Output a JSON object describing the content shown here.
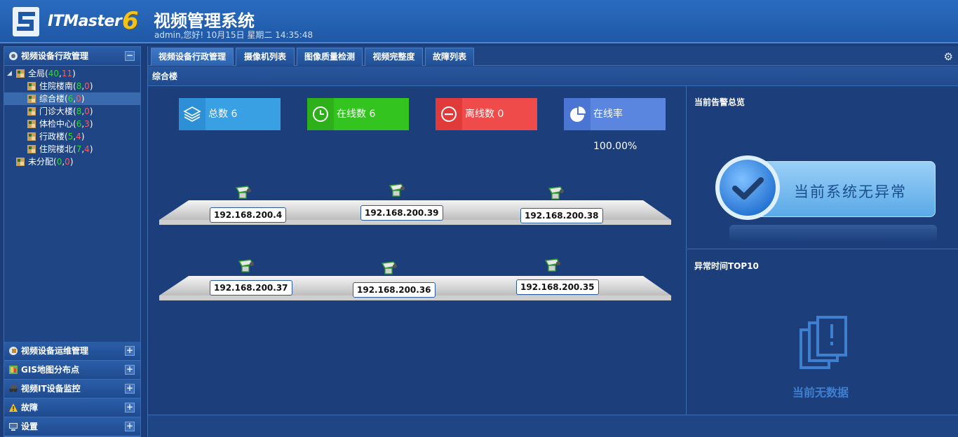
{
  "header": {
    "logo_text": "ITMaster",
    "logo_version": "6",
    "title": "视频管理系统",
    "subtitle": "admin,您好! 10月15日 星期二 14:35:48"
  },
  "sidebar": {
    "top_section": {
      "label": "视频设备行政管理",
      "toggle": "−"
    },
    "tree": [
      {
        "name": "全局",
        "online": "40",
        "offline": "11"
      },
      {
        "name": "住院楼南",
        "online": "8",
        "offline": "0"
      },
      {
        "name": "综合楼",
        "online": "6",
        "offline": "0"
      },
      {
        "name": "门诊大楼",
        "online": "8",
        "offline": "0"
      },
      {
        "name": "体检中心",
        "online": "6",
        "offline": "3"
      },
      {
        "name": "行政楼",
        "online": "5",
        "offline": "4"
      },
      {
        "name": "住院楼北",
        "online": "7",
        "offline": "4"
      },
      {
        "name": "未分配",
        "online": "0",
        "offline": "0"
      }
    ],
    "bottom_sections": [
      {
        "label": "视频设备运维管理",
        "toggle": "+"
      },
      {
        "label": "GIS地图分布点",
        "toggle": "+"
      },
      {
        "label": "视频IT设备监控",
        "toggle": "+"
      },
      {
        "label": "故障",
        "toggle": "+"
      },
      {
        "label": "设置",
        "toggle": "+"
      }
    ]
  },
  "tabs": [
    "视频设备行政管理",
    "摄像机列表",
    "图像质量检测",
    "视频完整度",
    "故障列表"
  ],
  "breadcrumb": "综合楼",
  "stats": [
    {
      "label": "总数 6",
      "color": "#3aa0e4",
      "icon_bg": "#2d8fd6",
      "icon": "layers-icon"
    },
    {
      "label": "在线数 6",
      "color": "#33c41f",
      "icon_bg": "#2db01a",
      "icon": "clock-icon"
    },
    {
      "label": "离线数 0",
      "color": "#f04b4b",
      "icon_bg": "#e03a3a",
      "icon": "minus-circle-icon"
    },
    {
      "label": "在线率 100.00%",
      "color": "#5b86e0",
      "icon_bg": "#4b75d2",
      "icon": "pie-chart-icon"
    }
  ],
  "cameras": {
    "shelf1": [
      "192.168.200.4",
      "192.168.200.39",
      "192.168.200.38"
    ],
    "shelf2": [
      "192.168.200.37",
      "192.168.200.36",
      "192.168.200.35"
    ]
  },
  "alarm_panel": {
    "title": "当前告警总览",
    "status": "当前系统无异常"
  },
  "top10_panel": {
    "title": "异常时间TOP10",
    "empty": "当前无数据"
  }
}
